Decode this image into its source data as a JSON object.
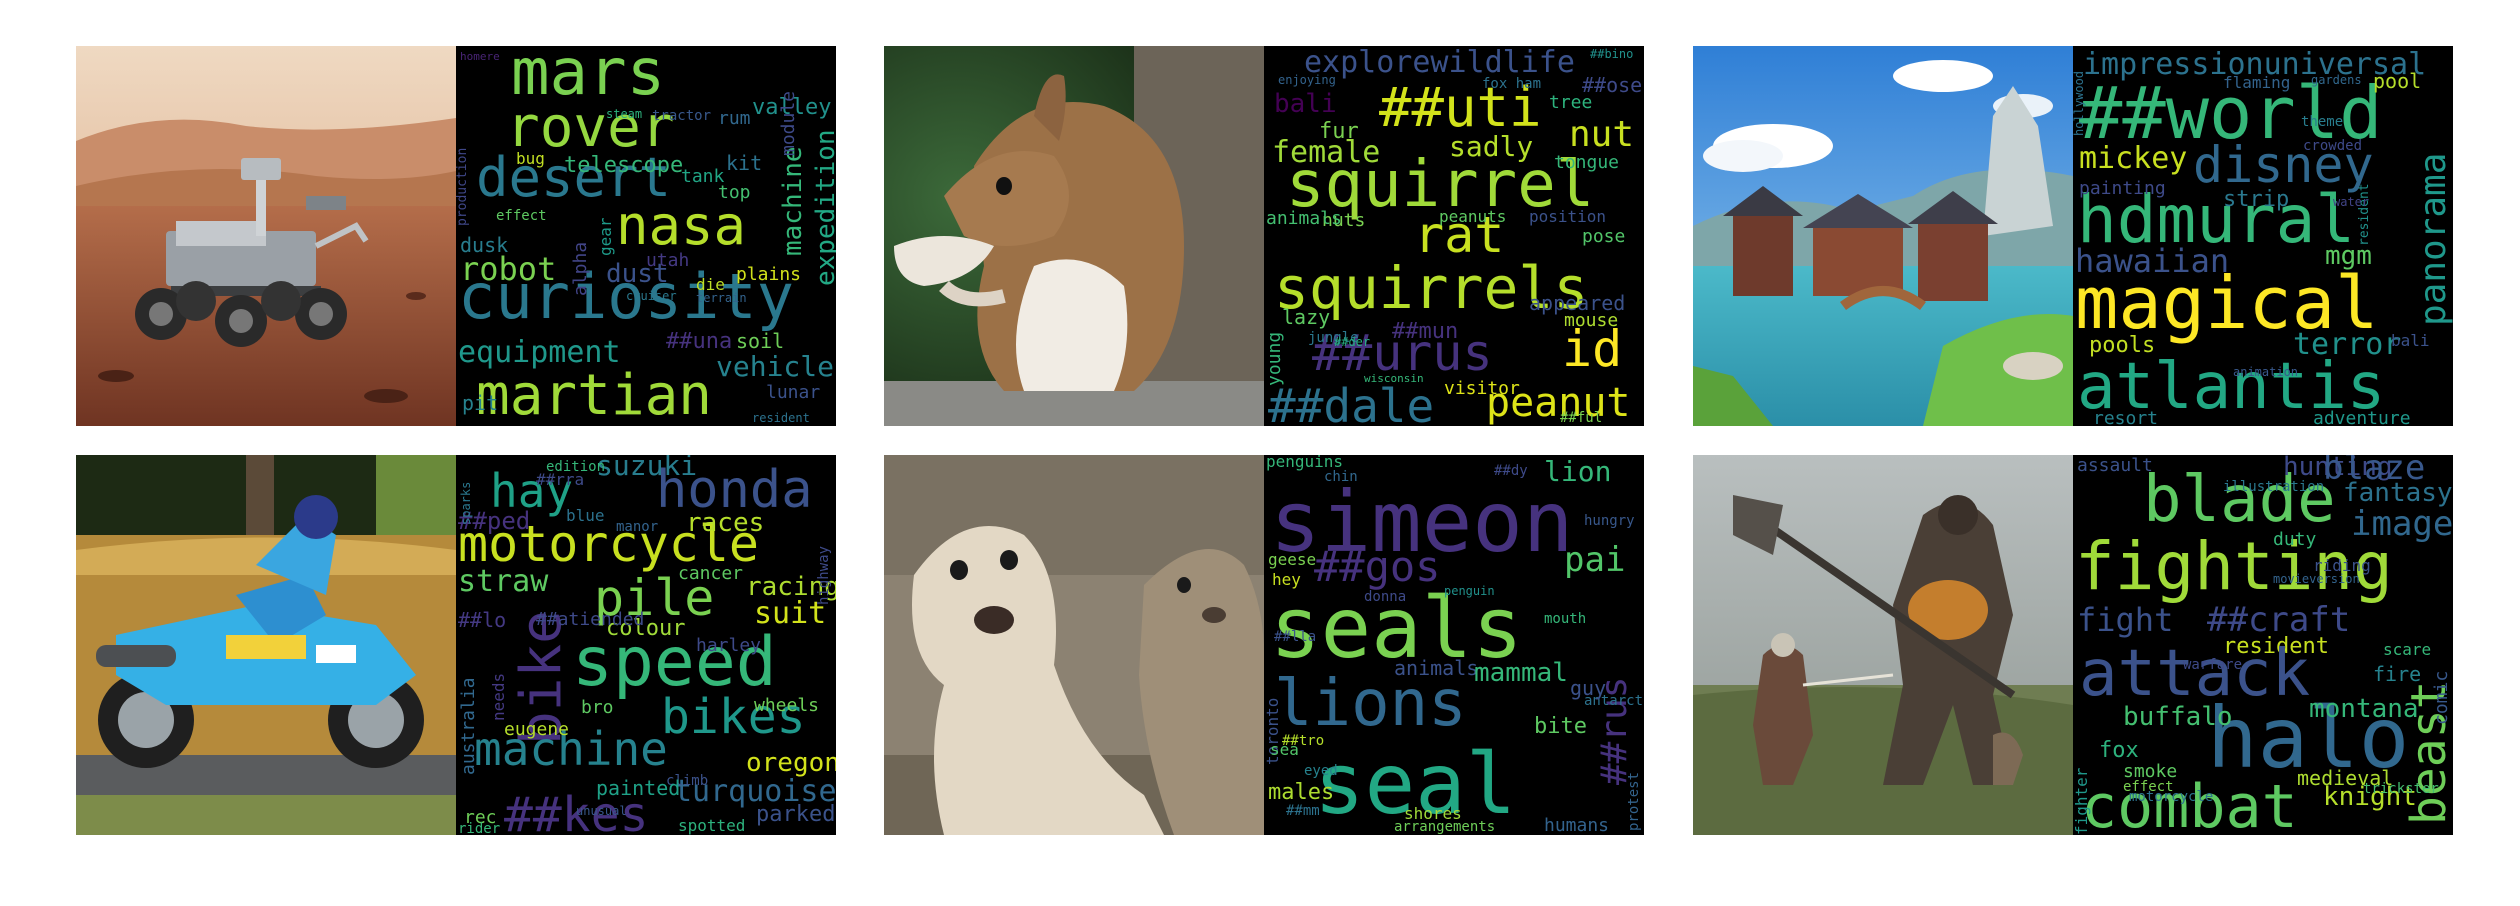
{
  "panels": [
    {
      "photo_subject": "mars-rover",
      "words": [
        {
          "text": "mars",
          "color": "#7ad151"
        },
        {
          "text": "rover",
          "color": "#95d840"
        },
        {
          "text": "desert",
          "color": "#2a788e"
        },
        {
          "text": "nasa",
          "color": "#b5de2b"
        },
        {
          "text": "curiosity",
          "color": "#2a788e"
        },
        {
          "text": "martian",
          "color": "#a0da39"
        },
        {
          "text": "robot",
          "color": "#7ad151"
        },
        {
          "text": "telescope",
          "color": "#35b779"
        },
        {
          "text": "equipment",
          "color": "#1f988b"
        },
        {
          "text": "machine",
          "color": "#35b779"
        },
        {
          "text": "expedition",
          "color": "#22a884"
        },
        {
          "text": "dust",
          "color": "#3b528b"
        },
        {
          "text": "dusk",
          "color": "#287d8e"
        },
        {
          "text": "alpha",
          "color": "#414487"
        },
        {
          "text": "vehicle",
          "color": "#26828e"
        },
        {
          "text": "valley",
          "color": "#21918c"
        },
        {
          "text": "module",
          "color": "#3e4a89"
        },
        {
          "text": "rum",
          "color": "#31688e"
        },
        {
          "text": "kit",
          "color": "#2c728e"
        },
        {
          "text": "tank",
          "color": "#21a585"
        },
        {
          "text": "top",
          "color": "#44bf70"
        },
        {
          "text": "bug",
          "color": "#c2df23"
        },
        {
          "text": "gear",
          "color": "#1e9b8a"
        },
        {
          "text": "utah",
          "color": "#443983"
        },
        {
          "text": "plains",
          "color": "#d2e21b"
        },
        {
          "text": "die",
          "color": "#bddf26"
        },
        {
          "text": "soil",
          "color": "#6ece58"
        },
        {
          "text": "##una",
          "color": "#46327e"
        },
        {
          "text": "lunar",
          "color": "#3b528b"
        },
        {
          "text": "resident",
          "color": "#2c728e"
        },
        {
          "text": "effect",
          "color": "#5ec962"
        },
        {
          "text": "steam",
          "color": "#2db27d"
        },
        {
          "text": "tractor",
          "color": "#38588c"
        },
        {
          "text": "production",
          "color": "#3f4788"
        },
        {
          "text": "cruiser",
          "color": "#2a788e"
        },
        {
          "text": "terrain",
          "color": "#33638d"
        },
        {
          "text": "homere",
          "color": "#482475"
        },
        {
          "text": "pit",
          "color": "#26828e"
        }
      ]
    },
    {
      "photo_subject": "squirrel",
      "words": [
        {
          "text": "explorewildlife",
          "color": "#3b528b"
        },
        {
          "text": "##uti",
          "color": "#d2e21b"
        },
        {
          "text": "squirrel",
          "color": "#a0da39"
        },
        {
          "text": "rat",
          "color": "#c8e020"
        },
        {
          "text": "squirrels",
          "color": "#b5de2b"
        },
        {
          "text": "##dale",
          "color": "#2c728e"
        },
        {
          "text": "peanut",
          "color": "#dde318"
        },
        {
          "text": "id",
          "color": "#fde725"
        },
        {
          "text": "##urus",
          "color": "#46327e"
        },
        {
          "text": "female",
          "color": "#a0da39"
        },
        {
          "text": "sadly",
          "color": "#b5de2b"
        },
        {
          "text": "nut",
          "color": "#c8e020"
        },
        {
          "text": "fur",
          "color": "#7ad151"
        },
        {
          "text": "bali",
          "color": "#440154"
        },
        {
          "text": "##ose",
          "color": "#3e4a89"
        },
        {
          "text": "tree",
          "color": "#2db27d"
        },
        {
          "text": "tongue",
          "color": "#35b779"
        },
        {
          "text": "nuts",
          "color": "#7ad151"
        },
        {
          "text": "peanuts",
          "color": "#5ec962"
        },
        {
          "text": "animals",
          "color": "#44bf70"
        },
        {
          "text": "position",
          "color": "#3b528b"
        },
        {
          "text": "pose",
          "color": "#52c569"
        },
        {
          "text": "appeared",
          "color": "#3b528b"
        },
        {
          "text": "lazy",
          "color": "#5ec962"
        },
        {
          "text": "young",
          "color": "#35b779"
        },
        {
          "text": "mouse",
          "color": "#addc30"
        },
        {
          "text": "visitor",
          "color": "#dde318"
        },
        {
          "text": "##mun",
          "color": "#46327e"
        },
        {
          "text": "jungle",
          "color": "#2a788e"
        },
        {
          "text": "enjoying",
          "color": "#33638d"
        },
        {
          "text": "fox ham",
          "color": "#2c728e"
        },
        {
          "text": "##bino",
          "color": "#21918c"
        },
        {
          "text": "wisconsin",
          "color": "#35b779"
        },
        {
          "text": "##ful",
          "color": "#7ad151"
        },
        {
          "text": "##der",
          "color": "#27ad81"
        }
      ]
    },
    {
      "photo_subject": "fantasy-town",
      "words": [
        {
          "text": "impressionuniversal",
          "color": "#2c728e"
        },
        {
          "text": "##world",
          "color": "#35b779"
        },
        {
          "text": "disney",
          "color": "#31688e"
        },
        {
          "text": "mickey",
          "color": "#c8e020"
        },
        {
          "text": "hdmural",
          "color": "#35b779"
        },
        {
          "text": "magical",
          "color": "#fde725"
        },
        {
          "text": "atlantis",
          "color": "#22a884"
        },
        {
          "text": "panorama",
          "color": "#1f988b"
        },
        {
          "text": "hawaiian",
          "color": "#3b528b"
        },
        {
          "text": "mgm",
          "color": "#5ec962"
        },
        {
          "text": "terror",
          "color": "#21918c"
        },
        {
          "text": "pools",
          "color": "#c2df23"
        },
        {
          "text": "painting",
          "color": "#3e4a89"
        },
        {
          "text": "strip",
          "color": "#2a788e"
        },
        {
          "text": "flaming",
          "color": "#33638d"
        },
        {
          "text": "pool",
          "color": "#b5de2b"
        },
        {
          "text": "gardens",
          "color": "#31688e"
        },
        {
          "text": "theme",
          "color": "#287d8e"
        },
        {
          "text": "resident",
          "color": "#21918c"
        },
        {
          "text": "adventure",
          "color": "#1f988b"
        },
        {
          "text": "resort",
          "color": "#26828e"
        },
        {
          "text": "bali",
          "color": "#3b528b"
        },
        {
          "text": "water",
          "color": "#414487"
        },
        {
          "text": "crowded",
          "color": "#3e4a89"
        },
        {
          "text": "hollywood",
          "color": "#2c728e"
        },
        {
          "text": "animation",
          "color": "#38588c"
        }
      ]
    },
    {
      "photo_subject": "motorcycle",
      "words": [
        {
          "text": "hay",
          "color": "#1fa187"
        },
        {
          "text": "honda",
          "color": "#3b528b"
        },
        {
          "text": "suzuki",
          "color": "#287d8e"
        },
        {
          "text": "motorcycle",
          "color": "#c8e020"
        },
        {
          "text": "races",
          "color": "#b5de2b"
        },
        {
          "text": "racing",
          "color": "#addc30"
        },
        {
          "text": "pile",
          "color": "#7ad151"
        },
        {
          "text": "suit",
          "color": "#d2e21b"
        },
        {
          "text": "straw",
          "color": "#5ec962"
        },
        {
          "text": "speed",
          "color": "#35b779"
        },
        {
          "text": "bike",
          "color": "#46327e"
        },
        {
          "text": "bikes",
          "color": "#1f988b"
        },
        {
          "text": "machine",
          "color": "#26828e"
        },
        {
          "text": "oregon",
          "color": "#d2e21b"
        },
        {
          "text": "turquoise",
          "color": "#31688e"
        },
        {
          "text": "##kes",
          "color": "#46327e"
        },
        {
          "text": "colour",
          "color": "#a0da39"
        },
        {
          "text": "cancer",
          "color": "#5ec962"
        },
        {
          "text": "harley",
          "color": "#3e4a89"
        },
        {
          "text": "wheels",
          "color": "#6ece58"
        },
        {
          "text": "climb",
          "color": "#3b528b"
        },
        {
          "text": "eugene",
          "color": "#b5de2b"
        },
        {
          "text": "painted",
          "color": "#1fa187"
        },
        {
          "text": "spotted",
          "color": "#2db27d"
        },
        {
          "text": "parked",
          "color": "#3b528b"
        },
        {
          "text": "##ped",
          "color": "#46327e"
        },
        {
          "text": "##lo",
          "color": "#443983"
        },
        {
          "text": "##rra",
          "color": "#3e4a89"
        },
        {
          "text": "edition",
          "color": "#35b779"
        },
        {
          "text": "australia",
          "color": "#31688e"
        },
        {
          "text": "needs",
          "color": "#443983"
        },
        {
          "text": "bro",
          "color": "#5ec962"
        },
        {
          "text": "blue",
          "color": "#2c728e"
        },
        {
          "text": "manor",
          "color": "#33638d"
        },
        {
          "text": "rec",
          "color": "#6ece58"
        },
        {
          "text": "rider",
          "color": "#35b779"
        },
        {
          "text": "highway",
          "color": "#3e4a89"
        },
        {
          "text": "unusual",
          "color": "#38588c"
        },
        {
          "text": "##atiended",
          "color": "#3e4a89"
        },
        {
          "text": "sparks",
          "color": "#2a788e"
        }
      ]
    },
    {
      "photo_subject": "seals",
      "words": [
        {
          "text": "simeon",
          "color": "#46327e"
        },
        {
          "text": "lion",
          "color": "#35b779"
        },
        {
          "text": "seals",
          "color": "#7ad151"
        },
        {
          "text": "lions",
          "color": "#31688e"
        },
        {
          "text": "seal",
          "color": "#22a884"
        },
        {
          "text": "##gos",
          "color": "#46327e"
        },
        {
          "text": "pai",
          "color": "#52c569"
        },
        {
          "text": "animals",
          "color": "#3b528b"
        },
        {
          "text": "mammal",
          "color": "#35b779"
        },
        {
          "text": "##rus",
          "color": "#46327e"
        },
        {
          "text": "penguins",
          "color": "#35b779"
        },
        {
          "text": "shores",
          "color": "#a0da39"
        },
        {
          "text": "humans",
          "color": "#33638d"
        },
        {
          "text": "males",
          "color": "#addc30"
        },
        {
          "text": "toronto",
          "color": "#3b528b"
        },
        {
          "text": "geese",
          "color": "#7ad151"
        },
        {
          "text": "hey",
          "color": "#c8e020"
        },
        {
          "text": "donna",
          "color": "#3e4a89"
        },
        {
          "text": "antarctic",
          "color": "#2c728e"
        },
        {
          "text": "hungry",
          "color": "#38588c"
        },
        {
          "text": "mouth",
          "color": "#35b779"
        },
        {
          "text": "bite",
          "color": "#5ec962"
        },
        {
          "text": "guy",
          "color": "#3b528b"
        },
        {
          "text": "sea",
          "color": "#52c569"
        },
        {
          "text": "arrangements",
          "color": "#6ece58"
        },
        {
          "text": "##mm",
          "color": "#2c728e"
        },
        {
          "text": "##tro",
          "color": "#b5de2b"
        },
        {
          "text": "chin",
          "color": "#31688e"
        },
        {
          "text": "##dy",
          "color": "#3e4a89"
        },
        {
          "text": "##lla",
          "color": "#3b528b"
        },
        {
          "text": "eyed",
          "color": "#26828e"
        },
        {
          "text": "protest",
          "color": "#33638d"
        },
        {
          "text": "penguin",
          "color": "#21918c"
        }
      ]
    },
    {
      "photo_subject": "battle-scene",
      "words": [
        {
          "text": "blade",
          "color": "#5ec962"
        },
        {
          "text": "hunting",
          "color": "#3e4a89"
        },
        {
          "text": "blaze",
          "color": "#38588c"
        },
        {
          "text": "fantasy",
          "color": "#2c728e"
        },
        {
          "text": "image",
          "color": "#31688e"
        },
        {
          "text": "fighting",
          "color": "#a0da39"
        },
        {
          "text": "fight",
          "color": "#3b528b"
        },
        {
          "text": "##craft",
          "color": "#3e4a89"
        },
        {
          "text": "resident",
          "color": "#c8e020"
        },
        {
          "text": "attack",
          "color": "#3b528b"
        },
        {
          "text": "halo",
          "color": "#31688e"
        },
        {
          "text": "beast",
          "color": "#6ece58"
        },
        {
          "text": "buffalo",
          "color": "#44bf70"
        },
        {
          "text": "montana",
          "color": "#35b779"
        },
        {
          "text": "fox",
          "color": "#2db27d"
        },
        {
          "text": "combat",
          "color": "#5ec962"
        },
        {
          "text": "knight",
          "color": "#b5de2b"
        },
        {
          "text": "fire",
          "color": "#26828e"
        },
        {
          "text": "medieval",
          "color": "#addc30"
        },
        {
          "text": "assault",
          "color": "#3b528b"
        },
        {
          "text": "illustration",
          "color": "#2a788e"
        },
        {
          "text": "duty",
          "color": "#35b779"
        },
        {
          "text": "warfare",
          "color": "#3e4a89"
        },
        {
          "text": "smoke",
          "color": "#5ec962"
        },
        {
          "text": "effect",
          "color": "#7ad151"
        },
        {
          "text": "motorcycle",
          "color": "#2c728e"
        },
        {
          "text": "fighter",
          "color": "#1f988b"
        },
        {
          "text": "riding",
          "color": "#3b528b"
        },
        {
          "text": "scare",
          "color": "#35b779"
        },
        {
          "text": "comic",
          "color": "#38588c"
        },
        {
          "text": "movieversion",
          "color": "#33638d"
        },
        {
          "text": "trickster",
          "color": "#44bf70"
        }
      ]
    }
  ]
}
